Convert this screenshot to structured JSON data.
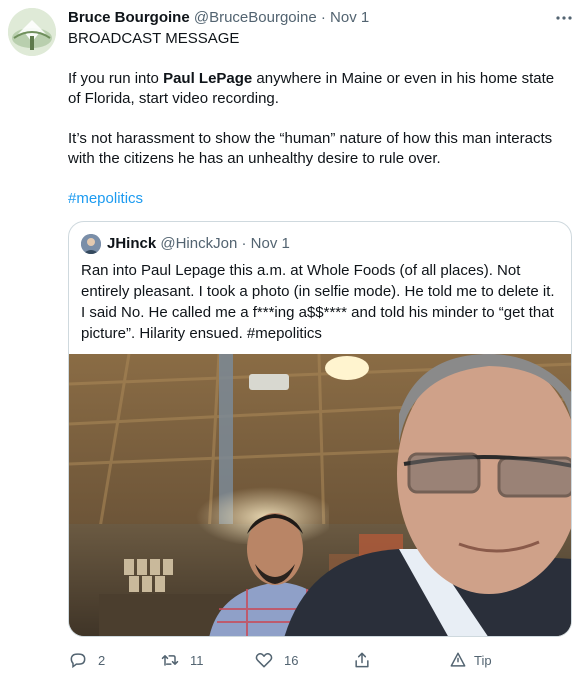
{
  "tweet": {
    "author_name": "Bruce Bourgoine",
    "author_handle": "@BruceBourgoine",
    "separator": "·",
    "date": "Nov 1",
    "line1": "BROADCAST MESSAGE",
    "para2_pre": "If you run into ",
    "para2_bold": "Paul LePage",
    "para2_post": " anywhere in Maine or even in his home state of Florida, start video recording.",
    "para3": "It’s not harassment to show the “human” nature of how this man interacts with the citizens he has an unhealthy desire to rule over.",
    "hashtag": "#mepolitics"
  },
  "quote": {
    "author_name": "JHinck",
    "author_handle": "@HinckJon",
    "separator": "·",
    "date": "Nov 1",
    "text": "Ran into Paul Lepage this a.m. at Whole Foods (of all places). Not entirely pleasant. I took a photo (in selfie mode). He told me to delete it. I said No. He called me a f***ing a$$**** and told his minder to “get that picture”. Hilarity ensued. #mepolitics"
  },
  "actions": {
    "reply_count": "2",
    "retweet_count": "11",
    "like_count": "16",
    "tip_label": "Tip"
  },
  "colors": {
    "link": "#1d9bf0",
    "muted": "#536471",
    "text": "#0f1419",
    "border": "#cfd9de"
  },
  "icons": [
    "more-icon",
    "reply-icon",
    "retweet-icon",
    "like-icon",
    "share-icon",
    "tip-icon"
  ]
}
